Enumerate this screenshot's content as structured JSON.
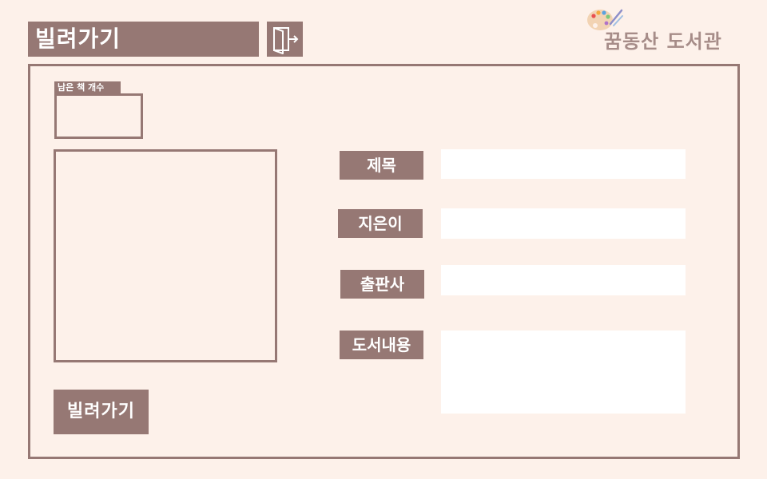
{
  "header": {
    "title": "빌려가기",
    "exit_icon": "door-exit-icon"
  },
  "brand": {
    "logo_icon": "palette-icon",
    "name": "꿈동산 도서관"
  },
  "book_panel": {
    "remaining_count_label": "남은 책 개수",
    "remaining_count_value": "",
    "cover_image": ""
  },
  "form": {
    "title_label": "제목",
    "title_value": "",
    "author_label": "지은이",
    "author_value": "",
    "publisher_label": "출판사",
    "publisher_value": "",
    "description_label": "도서내용",
    "description_value": ""
  },
  "actions": {
    "rent_label": "빌려가기"
  },
  "colors": {
    "background": "#fdf1ea",
    "accent": "#967874",
    "brand_text": "#a68c88",
    "input_bg": "#ffffff"
  }
}
